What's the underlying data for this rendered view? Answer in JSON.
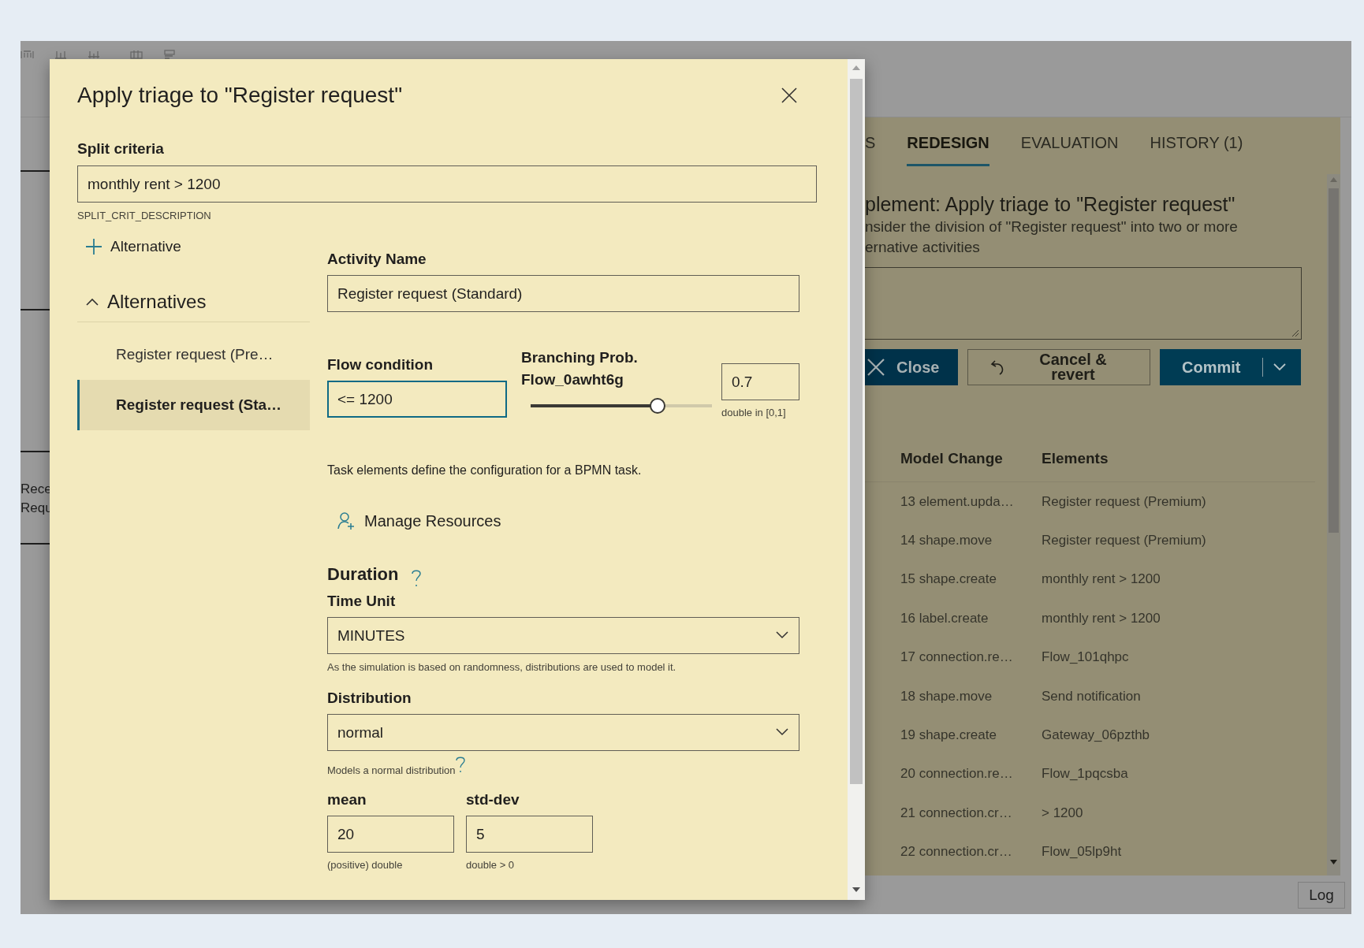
{
  "app": {
    "canvas_labels": [
      "Rece",
      "Requ"
    ],
    "log_button": "Log"
  },
  "panel": {
    "tabs": [
      {
        "label": "S",
        "selected": false
      },
      {
        "label": "REDESIGN",
        "selected": true
      },
      {
        "label": "EVALUATION",
        "selected": false
      },
      {
        "label": "HISTORY (1)",
        "selected": false
      }
    ],
    "heading": "plement: Apply triage to \"Register request\"",
    "description_lines": [
      "nsider the division of \"Register request\" into two or more",
      "ernative activities"
    ],
    "buttons": [
      {
        "label": "Close",
        "kind": "close"
      },
      {
        "label": "Cancel & revert",
        "kind": "revert"
      },
      {
        "label": "Commit",
        "kind": "commit"
      }
    ],
    "history": {
      "columns": [
        "Model Change",
        "Elements"
      ],
      "rows": [
        {
          "change": "13 element.upda…",
          "element": "Register request (Premium)"
        },
        {
          "change": "14 shape.move",
          "element": "Register request (Premium)"
        },
        {
          "change": "15 shape.create",
          "element": "monthly rent > 1200"
        },
        {
          "change": "16 label.create",
          "element": "monthly rent > 1200"
        },
        {
          "change": "17 connection.re…",
          "element": "Flow_101qhpc"
        },
        {
          "change": "18 shape.move",
          "element": "Send notification"
        },
        {
          "change": "19 shape.create",
          "element": "Gateway_06pzthb"
        },
        {
          "change": "20 connection.re…",
          "element": "Flow_1pqcsba"
        },
        {
          "change": "21 connection.cr…",
          "element": "> 1200"
        },
        {
          "change": "22 connection.cr…",
          "element": "Flow_05lp9ht"
        }
      ]
    }
  },
  "dialog": {
    "title": "Apply triage to \"Register request\"",
    "split_criteria": {
      "label": "Split criteria",
      "value": "monthly rent > 1200",
      "description": "SPLIT_CRIT_DESCRIPTION"
    },
    "add_alternative": "Alternative",
    "alternatives": {
      "heading": "Alternatives",
      "expanded": true,
      "items": [
        {
          "label": "Register request (Pre…",
          "selected": false
        },
        {
          "label": "Register request (Sta…",
          "selected": true
        }
      ]
    },
    "activity_name": {
      "label": "Activity Name",
      "value": "Register request (Standard)"
    },
    "flow_condition": {
      "label": "Flow condition",
      "value": "<= 1200",
      "focused": true
    },
    "branching": {
      "label_lines": [
        "Branching Prob.",
        "Flow_0awht6g"
      ],
      "level": 0.7,
      "value": "0.7",
      "hint": "double in [0,1]"
    },
    "task_text": "Task elements define the configuration for a BPMN task.",
    "manage_resources": "Manage Resources",
    "duration": {
      "heading": "Duration",
      "time_unit": {
        "label": "Time Unit",
        "value": "MINUTES",
        "hint": "As the simulation is based on randomness, distributions are used to model it."
      },
      "distribution": {
        "label": "Distribution",
        "value": "normal",
        "hint": "Models a normal distribution"
      },
      "mean": {
        "label": "mean",
        "value": "20",
        "hint": "(positive) double"
      },
      "std_dev": {
        "label": "std-dev",
        "value": "5",
        "hint": "double > 0"
      }
    }
  }
}
